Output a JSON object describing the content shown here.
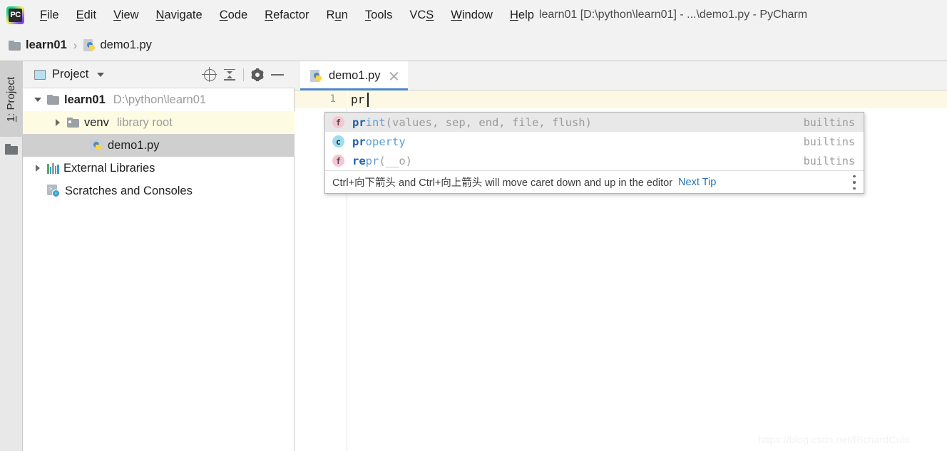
{
  "window": {
    "title": "learn01 [D:\\python\\learn01] - ...\\demo1.py - PyCharm",
    "logo_text": "PC",
    "logo_icon": "pycharm-logo-icon"
  },
  "menubar": {
    "items": [
      {
        "label": "File",
        "mnemonic_index": 0
      },
      {
        "label": "Edit",
        "mnemonic_index": 0
      },
      {
        "label": "View",
        "mnemonic_index": 0
      },
      {
        "label": "Navigate",
        "mnemonic_index": 0
      },
      {
        "label": "Code",
        "mnemonic_index": 0
      },
      {
        "label": "Refactor",
        "mnemonic_index": 0
      },
      {
        "label": "Run",
        "mnemonic_index": 1
      },
      {
        "label": "Tools",
        "mnemonic_index": 0
      },
      {
        "label": "VCS",
        "mnemonic_index": 2
      },
      {
        "label": "Window",
        "mnemonic_index": 0
      },
      {
        "label": "Help",
        "mnemonic_index": 0
      }
    ]
  },
  "breadcrumb": {
    "project": "learn01",
    "separator": "›",
    "file": "demo1.py",
    "folder_icon": "folder-icon",
    "file_icon": "python-file-icon"
  },
  "toolstrip": {
    "project_tab_number": "1",
    "project_tab_label": ": Project",
    "folder_icon": "folder-icon"
  },
  "project_panel": {
    "header": {
      "title": "Project",
      "view_icon": "project-view-icon",
      "caret_icon": "chevron-down-icon",
      "locate_icon": "locate-target-icon",
      "collapse_icon": "collapse-all-icon",
      "settings_icon": "gear-icon",
      "hide_icon": "minimize-icon"
    },
    "tree": [
      {
        "label": "learn01",
        "sub": "D:\\python\\learn01",
        "icon": "folder-icon",
        "arrow": "down",
        "bold": true,
        "indent": 0,
        "state": "normal"
      },
      {
        "label": "venv",
        "sub": "library root",
        "icon": "library-folder-icon",
        "arrow": "right",
        "bold": false,
        "indent": 1,
        "state": "highlight"
      },
      {
        "label": "demo1.py",
        "sub": "",
        "icon": "python-file-icon",
        "arrow": "none",
        "bold": false,
        "indent": 2,
        "state": "selected"
      },
      {
        "label": "External Libraries",
        "sub": "",
        "icon": "libraries-icon",
        "arrow": "right",
        "bold": false,
        "indent": 0,
        "state": "normal"
      },
      {
        "label": "Scratches and Consoles",
        "sub": "",
        "icon": "scratches-icon",
        "arrow": "none",
        "bold": false,
        "indent": 0,
        "state": "normal"
      }
    ]
  },
  "editor": {
    "tab": {
      "label": "demo1.py",
      "file_icon": "python-file-icon",
      "close_icon": "close-icon"
    },
    "line_number": "1",
    "code": "pr"
  },
  "autocomplete": {
    "items": [
      {
        "kind": "f",
        "kind_name": "function-badge",
        "prefix": "pr",
        "name_rest": "int",
        "signature": "(values, sep, end, file, flush)",
        "source": "builtins",
        "selected": true
      },
      {
        "kind": "c",
        "kind_name": "class-badge",
        "prefix": "pr",
        "name_rest": "operty",
        "signature": "",
        "source": "builtins",
        "selected": false
      },
      {
        "kind": "f",
        "kind_name": "function-badge",
        "prefix": "re",
        "name_rest": "pr",
        "signature": "(__o)",
        "source": "builtins",
        "selected": false
      }
    ],
    "tip": {
      "text": "Ctrl+向下箭头 and Ctrl+向上箭头 will move caret down and up in the editor",
      "link": "Next Tip",
      "menu_icon": "more-options-icon"
    }
  },
  "watermark": {
    "text": "https://blog.csdn.net/RichardCuio"
  },
  "colors": {
    "accent_tab_underline": "#4a86c8",
    "current_line": "#fcf8e3",
    "selection": "#cfcfcf",
    "tree_highlight": "#fdfbe2",
    "chrome": "#f2f2f2",
    "link": "#2470b3",
    "code_blue": "#5b9bd5"
  }
}
